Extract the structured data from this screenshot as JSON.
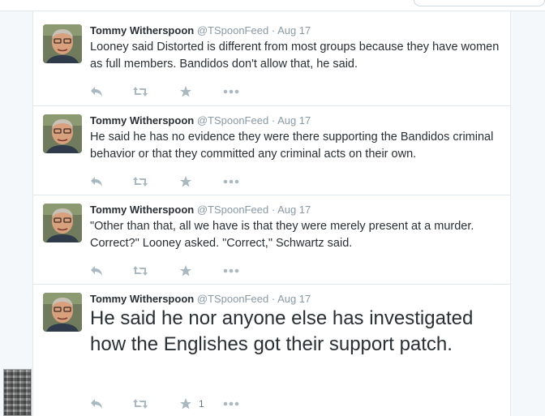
{
  "tweets": [
    {
      "fullname": "Tommy Witherspoon",
      "username": "@TSpoonFeed",
      "separator": "·",
      "time": "Aug 17",
      "text": "Looney said Distorted is different from most groups because they have women as full members. Bandidos don't allow that, he said.",
      "large_text": false,
      "favorites": ""
    },
    {
      "fullname": "Tommy Witherspoon",
      "username": "@TSpoonFeed",
      "separator": "·",
      "time": "Aug 17",
      "text": "He said he has no evidence they were there supporting the Bandidos criminal behavior or that they committed any criminal acts on their own.",
      "large_text": false,
      "favorites": ""
    },
    {
      "fullname": "Tommy Witherspoon",
      "username": "@TSpoonFeed",
      "separator": "·",
      "time": "Aug 17",
      "text": "\"Other than that, all we have is that they were merely present at a murder. Correct?\" Looney asked. \"Correct,\" Schwartz said.",
      "large_text": false,
      "favorites": ""
    },
    {
      "fullname": "Tommy Witherspoon",
      "username": "@TSpoonFeed",
      "separator": "·",
      "time": "Aug 17",
      "text": "He said he nor anyone else has investigated how the Englishes got their support patch.",
      "large_text": true,
      "favorites": "1"
    }
  ],
  "icons": {
    "reply": "reply-icon",
    "retweet": "retweet-icon",
    "favorite": "star-icon",
    "more": "more-dots-icon"
  },
  "colors": {
    "name": "#292f33",
    "meta": "#8899a6",
    "action": "#aab8c2",
    "border": "#e1e8ed",
    "background": "#f5f8fa"
  }
}
